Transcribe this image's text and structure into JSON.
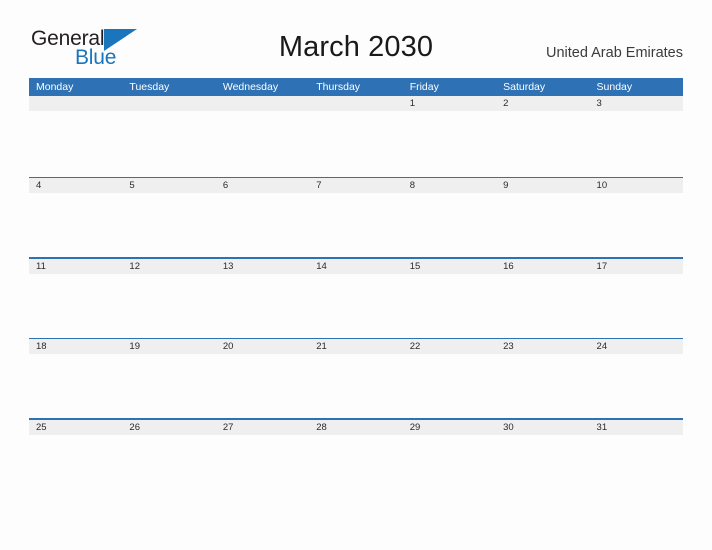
{
  "brand": {
    "word_one": "General",
    "word_two": "Blue",
    "flag_icon": "blue-triangle-flag",
    "color_primary": "#1A75BC",
    "color_text": "#231F20"
  },
  "header": {
    "title": "March 2030",
    "region": "United Arab Emirates"
  },
  "theme": {
    "header_blue": "#2E72B5",
    "rule_blue": "#2E72B5",
    "day_band_gray": "#EFEFEF",
    "page_background": "#FDFDFD",
    "day_number_color": "#2B2B2B"
  },
  "calendar": {
    "weekdays": [
      "Monday",
      "Tuesday",
      "Wednesday",
      "Thursday",
      "Friday",
      "Saturday",
      "Sunday"
    ],
    "weeks": [
      [
        "",
        "",
        "",
        "",
        "1",
        "2",
        "3"
      ],
      [
        "4",
        "5",
        "6",
        "7",
        "8",
        "9",
        "10"
      ],
      [
        "11",
        "12",
        "13",
        "14",
        "15",
        "16",
        "17"
      ],
      [
        "18",
        "19",
        "20",
        "21",
        "22",
        "23",
        "24"
      ],
      [
        "25",
        "26",
        "27",
        "28",
        "29",
        "30",
        "31"
      ]
    ]
  }
}
